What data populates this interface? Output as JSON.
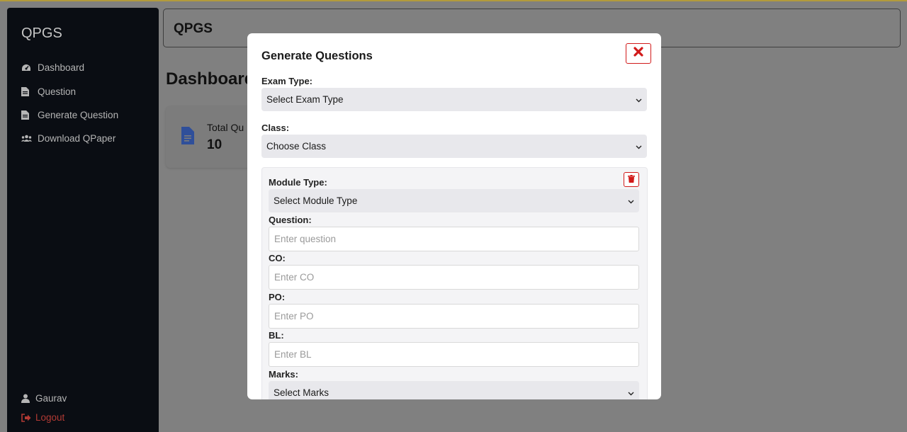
{
  "sidebar": {
    "brand": "QPGS",
    "items": [
      {
        "label": "Dashboard",
        "icon": "tachometer-icon"
      },
      {
        "label": "Question",
        "icon": "file-icon"
      },
      {
        "label": "Generate Question",
        "icon": "file-icon"
      },
      {
        "label": "Download QPaper",
        "icon": "users-icon"
      }
    ],
    "user": {
      "name": "Gaurav",
      "icon": "user-icon"
    },
    "logout": {
      "label": "Logout",
      "icon": "sign-out-icon",
      "color": "#b23a34"
    }
  },
  "header": {
    "title": "QPGS"
  },
  "main": {
    "heading": "Dashboard",
    "stat_card": {
      "label": "Total Qu",
      "value": "10",
      "icon": "file-alt-icon",
      "icon_color": "#2f63d6"
    }
  },
  "modal": {
    "title": "Generate Questions",
    "close_icon": "close-icon",
    "close_color": "#d11a1a",
    "exam_type": {
      "label": "Exam Type:",
      "value": "Select Exam Type"
    },
    "class": {
      "label": "Class:",
      "value": "Choose Class"
    },
    "module": {
      "delete_icon": "trash-icon",
      "module_type": {
        "label": "Module Type:",
        "value": "Select Module Type"
      },
      "question": {
        "label": "Question:",
        "placeholder": "Enter question"
      },
      "co": {
        "label": "CO:",
        "placeholder": "Enter CO"
      },
      "po": {
        "label": "PO:",
        "placeholder": "Enter PO"
      },
      "bl": {
        "label": "BL:",
        "placeholder": "Enter BL"
      },
      "marks": {
        "label": "Marks:",
        "value": "Select Marks"
      }
    }
  }
}
